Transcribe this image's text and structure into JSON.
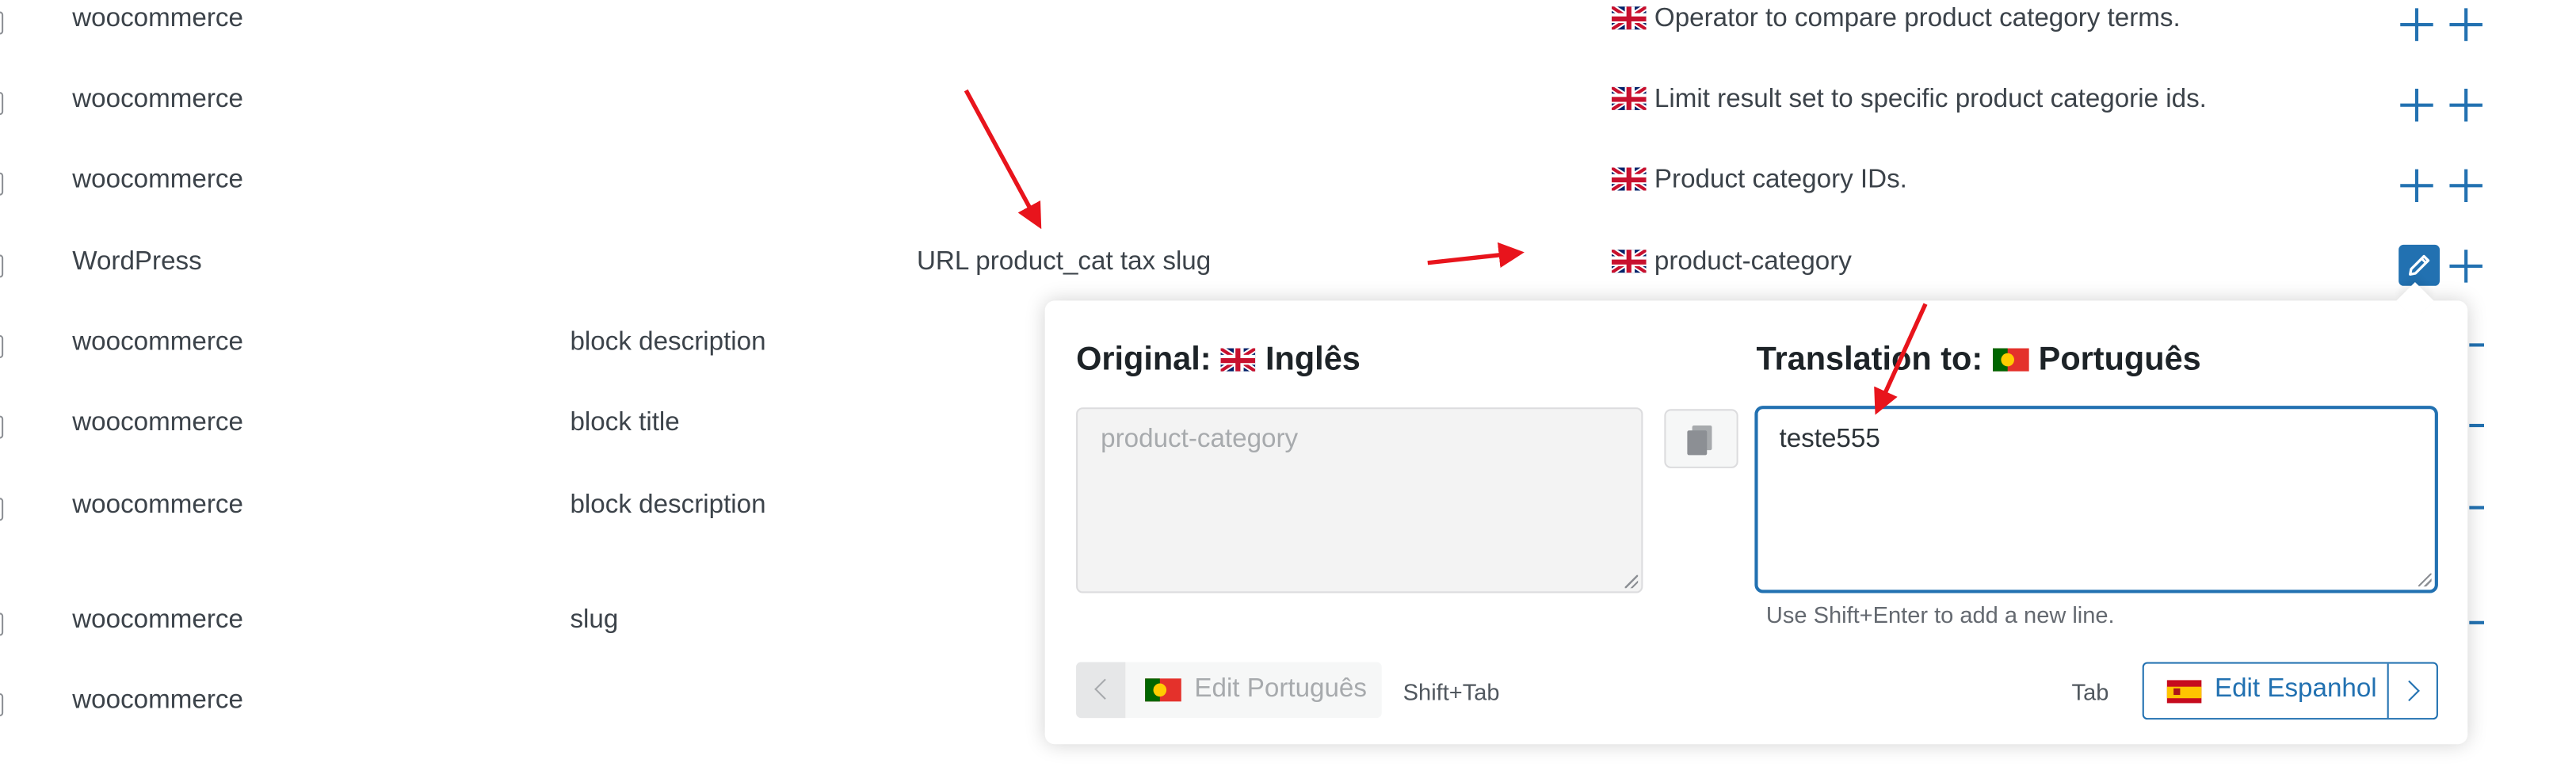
{
  "colors": {
    "accent": "#2271b1",
    "annotation": "#e8141c",
    "text": "#3c434a"
  },
  "rows": [
    {
      "context": "woocommerce",
      "comment": "",
      "original": "",
      "translation": "Operator to compare product category terms."
    },
    {
      "context": "woocommerce",
      "comment": "",
      "original": "",
      "translation": "Limit result set to specific product categorie ids."
    },
    {
      "context": "woocommerce",
      "comment": "",
      "original": "",
      "translation": "Product category IDs."
    },
    {
      "context": "WordPress",
      "comment": "",
      "original": "URL product_cat tax slug",
      "translation": "product-category"
    },
    {
      "context": "woocommerce",
      "comment": "block description",
      "original": "",
      "translation": ""
    },
    {
      "context": "woocommerce",
      "comment": "block title",
      "original": "",
      "translation": ""
    },
    {
      "context": "woocommerce",
      "comment": "block description",
      "original": "",
      "translation": ""
    },
    {
      "context": "woocommerce",
      "comment": "slug",
      "original": "",
      "translation": ""
    },
    {
      "context": "woocommerce",
      "comment": "",
      "original": "",
      "translation": ""
    }
  ],
  "row_icons": {
    "flag": "uk-flag-icon",
    "add": "plus-icon",
    "edit": "pencil-icon"
  },
  "popover": {
    "original_label": "Original:",
    "original_language": "Inglês",
    "original_text": "product-category",
    "translation_label": "Translation to:",
    "translation_language": "Português",
    "translation_value": "teste555",
    "hint": "Use Shift+Enter to add a new line.",
    "prev_label": "Edit Português",
    "prev_shortcut": "Shift+Tab",
    "next_shortcut": "Tab",
    "next_label": "Edit Espanhol",
    "icons": {
      "copy": "copy-icon",
      "prev": "chevron-left-icon",
      "next": "chevron-right-icon"
    }
  }
}
